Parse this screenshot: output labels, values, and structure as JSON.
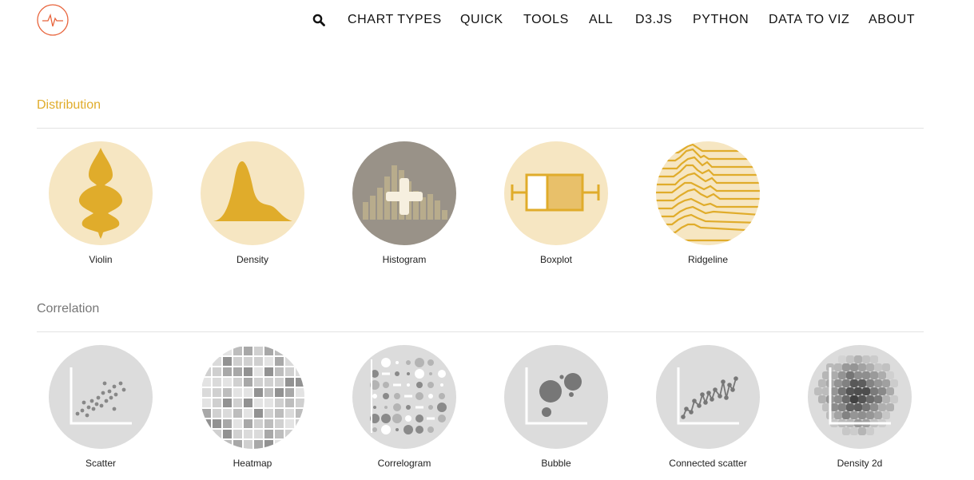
{
  "nav": {
    "items": [
      "CHART TYPES",
      "QUICK",
      "TOOLS",
      "ALL",
      "D3.JS",
      "PYTHON",
      "DATA TO VIZ",
      "ABOUT"
    ]
  },
  "sections": [
    {
      "title": "Distribution",
      "color": "#e0ac2b",
      "items": [
        {
          "label": "Violin",
          "icon": "violin-chart-icon"
        },
        {
          "label": "Density",
          "icon": "density-chart-icon"
        },
        {
          "label": "Histogram",
          "icon": "histogram-chart-icon"
        },
        {
          "label": "Boxplot",
          "icon": "boxplot-chart-icon"
        },
        {
          "label": "Ridgeline",
          "icon": "ridgeline-chart-icon"
        }
      ]
    },
    {
      "title": "Correlation",
      "color": "#777777",
      "items": [
        {
          "label": "Scatter",
          "icon": "scatter-chart-icon"
        },
        {
          "label": "Heatmap",
          "icon": "heatmap-chart-icon"
        },
        {
          "label": "Correlogram",
          "icon": "correlogram-chart-icon"
        },
        {
          "label": "Bubble",
          "icon": "bubble-chart-icon"
        },
        {
          "label": "Connected scatter",
          "icon": "connected-scatter-chart-icon"
        },
        {
          "label": "Density 2d",
          "icon": "density-2d-chart-icon"
        }
      ]
    }
  ],
  "colors": {
    "accent": "#e0ac2b",
    "accent_light": "#f6e6c2",
    "histogram_bg": "#999288",
    "grey_circle": "#dcdcdc",
    "logo": "#e8643c"
  }
}
